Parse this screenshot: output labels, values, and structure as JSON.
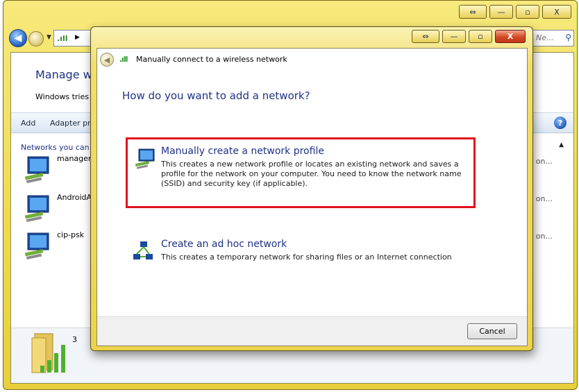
{
  "background_window": {
    "caption_buttons": [
      "⇔",
      "—",
      "▫",
      "X"
    ],
    "search_placeholder": "Ne...",
    "heading": "Manage wi",
    "subtext": "Windows tries t",
    "toolbar": {
      "add_label": "Add",
      "adapter_label": "Adapter pr",
      "help_label": "?"
    },
    "group_label": "Networks you can",
    "networks": [
      {
        "name": "managem",
        "right_text": "on..."
      },
      {
        "name": "AndroidA",
        "right_text": "on..."
      },
      {
        "name": "cip-psk",
        "right_text": "on..."
      }
    ],
    "bottom_count": "3"
  },
  "dialog": {
    "caption_buttons": [
      "⇔",
      "—",
      "▫",
      "X"
    ],
    "title": "Manually connect to a wireless network",
    "question": "How do you want to add a network?",
    "options": [
      {
        "title": "Manually create a network profile",
        "description": "This creates a new network profile or locates an existing network and saves a profile for the network on your computer. You need to know the network name (SSID) and security key (if applicable).",
        "icon": "network-computer-icon",
        "highlighted": true,
        "highlight_color": "#e0121b"
      },
      {
        "title": "Create an ad hoc network",
        "description": "This creates a temporary network for sharing files or an Internet connection",
        "icon": "adhoc-network-icon",
        "highlighted": false
      }
    ],
    "cancel_label": "Cancel"
  },
  "colors": {
    "title_blue": "#1e3287",
    "frame_yellow": "#efd94a",
    "close_red": "#d24a24"
  }
}
